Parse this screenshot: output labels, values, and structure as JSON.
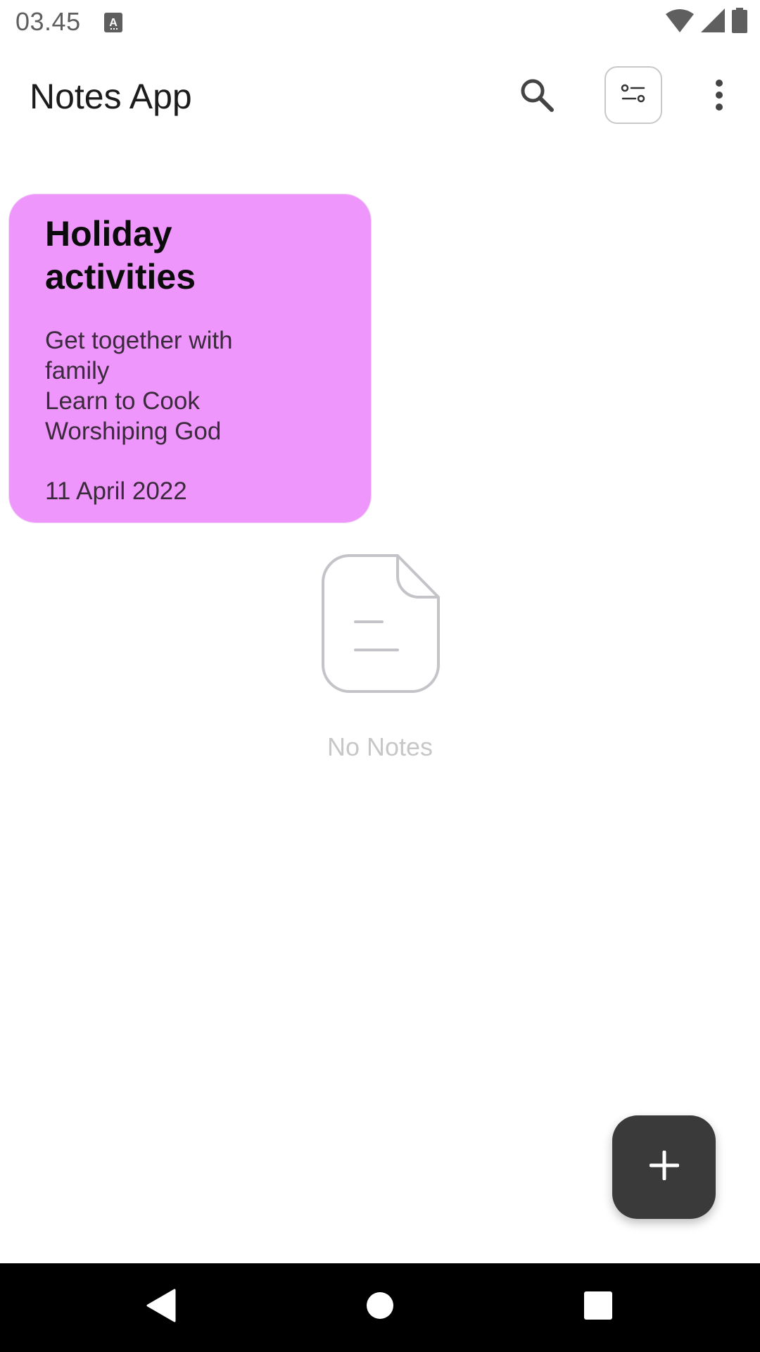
{
  "status_bar": {
    "time": "03.45",
    "icons": [
      "keyboard-a-icon",
      "wifi-icon",
      "signal-icon",
      "battery-icon"
    ]
  },
  "app_bar": {
    "title": "Notes App",
    "actions": [
      "search-icon",
      "filter-icon",
      "more-vert-icon"
    ]
  },
  "notes": [
    {
      "title": "Holiday activities",
      "body_lines": [
        "Get together with",
        "family",
        "Learn to Cook",
        "Worshiping God"
      ],
      "date": "11 April 2022",
      "color": "#ef96fc"
    }
  ],
  "empty_state": {
    "icon": "document-icon",
    "text": "No Notes"
  },
  "fab": {
    "icon": "plus-icon"
  },
  "nav_bar": {
    "buttons": [
      "back-icon",
      "home-icon",
      "recents-icon"
    ]
  },
  "colors": {
    "note_card": "#ef96fc",
    "fab": "#3a3a3a",
    "nav_bar": "#000000"
  }
}
